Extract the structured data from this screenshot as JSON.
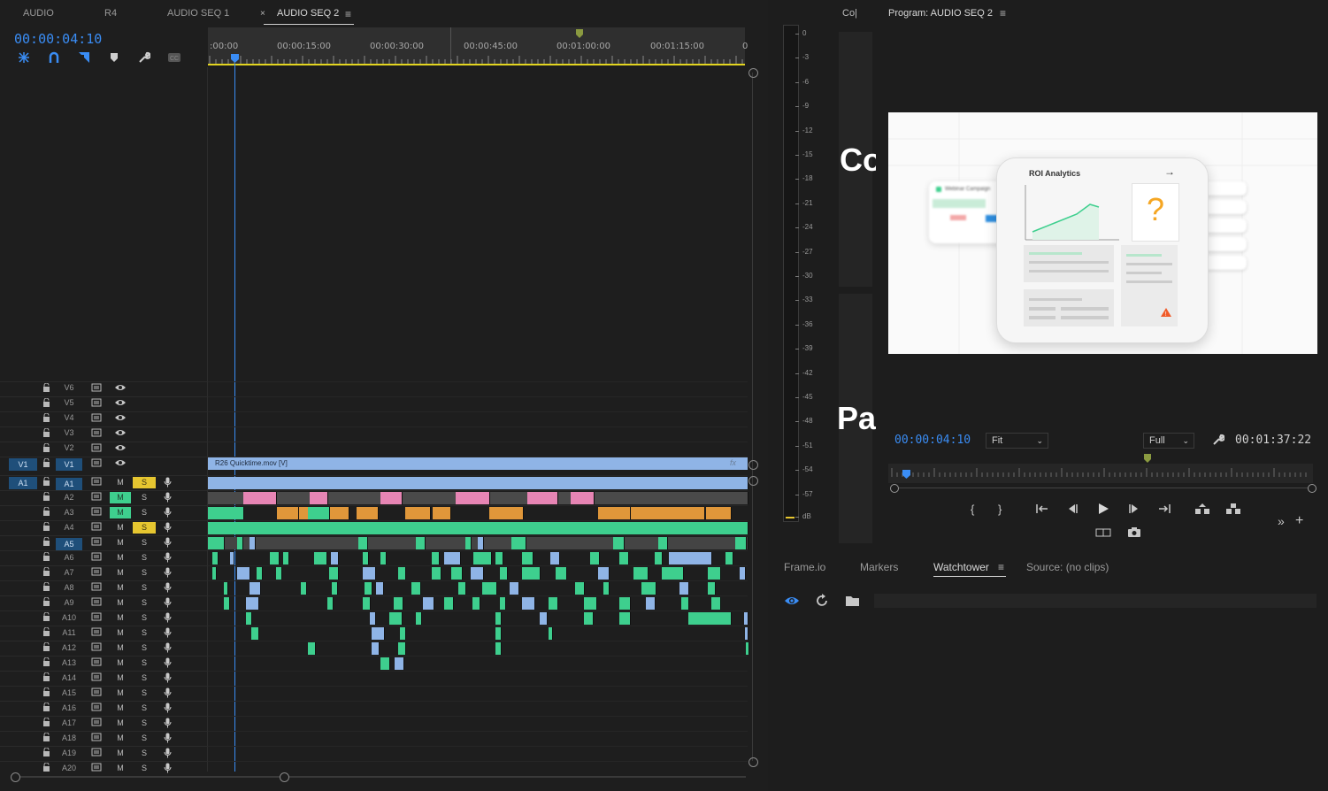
{
  "timeline": {
    "tabs": [
      "AUDIO",
      "R4",
      "AUDIO SEQ 1",
      "AUDIO SEQ 2"
    ],
    "active_tab": "AUDIO SEQ 2",
    "timecode": "00:00:04:10",
    "ruler_labels": [
      ":00:00",
      "00:00:15:00",
      "00:00:30:00",
      "00:00:45:00",
      "00:01:00:00",
      "00:01:15:00",
      "0"
    ],
    "video_tracks": [
      "V6",
      "V5",
      "V4",
      "V3",
      "V2",
      "V1"
    ],
    "audio_tracks": [
      "A1",
      "A2",
      "A3",
      "A4",
      "A5",
      "A6",
      "A7",
      "A8",
      "A9",
      "A10",
      "A11",
      "A12",
      "A13",
      "A14",
      "A15",
      "A16",
      "A17",
      "A18",
      "A19",
      "A20"
    ],
    "source_video": "V1",
    "source_audio": "A1",
    "mute_label": "M",
    "solo_label": "S",
    "video_clip_label": "R26 Quicktime.mov [V]",
    "fx_label": "fx"
  },
  "meter": {
    "scale": [
      "0",
      "-3",
      "-6",
      "-9",
      "-12",
      "-15",
      "-18",
      "-21",
      "-24",
      "-27",
      "-30",
      "-33",
      "-36",
      "-39",
      "-42",
      "-45",
      "-48",
      "-51",
      "-54",
      "-57",
      "dB"
    ]
  },
  "source_panel": {
    "tab_label": "Co|",
    "big_text_1": "Co",
    "big_text_2": "Pa"
  },
  "program": {
    "title": "Program: AUDIO SEQ 2",
    "timecode": "00:00:04:10",
    "fit_value": "Fit",
    "quality_value": "Full",
    "duration": "00:01:37:22",
    "card_title": "ROI Analytics",
    "card_arrow": "→",
    "card_question": "?",
    "card_warning": "!",
    "back_card_title": "Webinar Campaign"
  },
  "bottom_panel": {
    "tabs": [
      "Frame.io",
      "Markers",
      "Watchtower",
      "Source: (no clips)"
    ],
    "active_tab": "Watchtower"
  },
  "colors": {
    "accent_blue": "#3a8df5",
    "audio_green": "#3ecf8e",
    "solo_yellow": "#e6c630",
    "clip_pink": "#e785b4",
    "clip_orange": "#e0973a",
    "clip_blue": "#8fb4e6"
  }
}
